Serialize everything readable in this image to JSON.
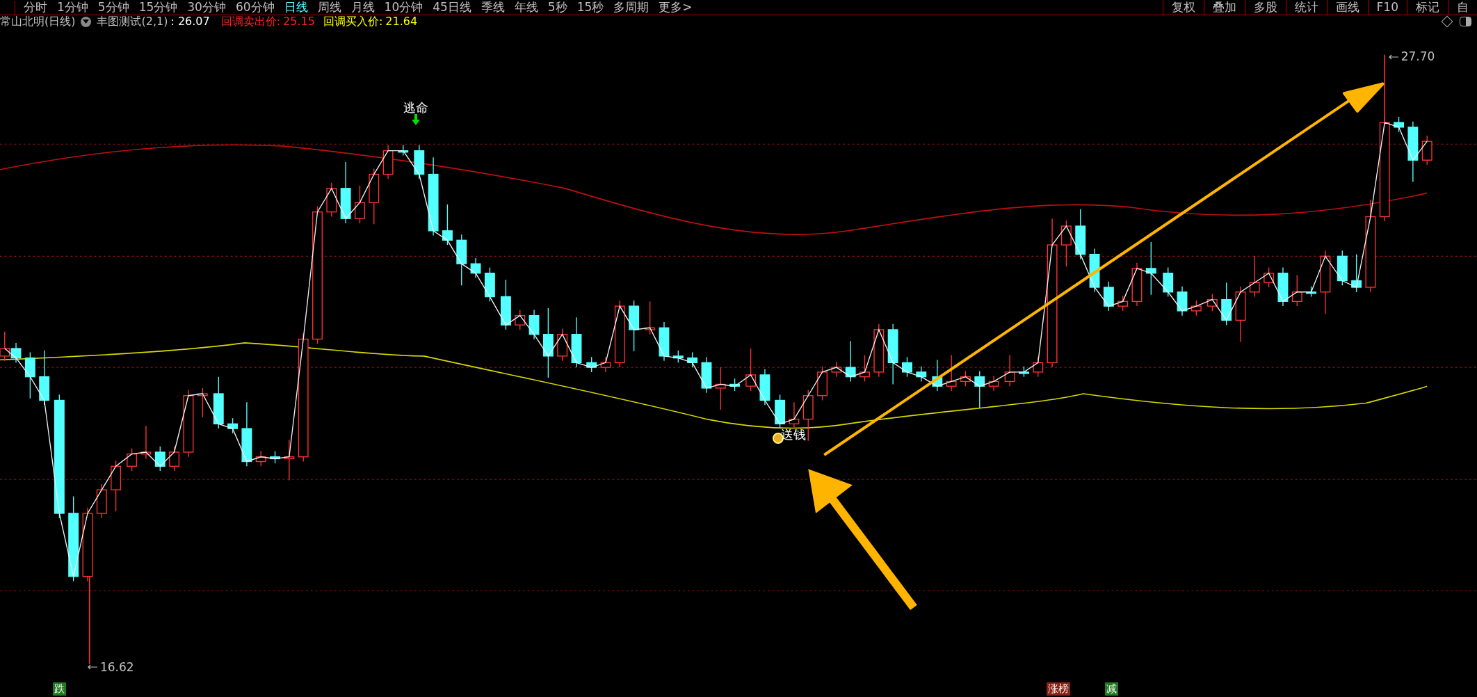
{
  "toolbar": {
    "periods": [
      {
        "label": "分时",
        "selected": false
      },
      {
        "label": "1分钟",
        "selected": false
      },
      {
        "label": "5分钟",
        "selected": false
      },
      {
        "label": "15分钟",
        "selected": false
      },
      {
        "label": "30分钟",
        "selected": false
      },
      {
        "label": "60分钟",
        "selected": false
      },
      {
        "label": "日线",
        "selected": true
      },
      {
        "label": "周线",
        "selected": false
      },
      {
        "label": "月线",
        "selected": false
      },
      {
        "label": "10分钟",
        "selected": false
      },
      {
        "label": "45日线",
        "selected": false
      },
      {
        "label": "季线",
        "selected": false
      },
      {
        "label": "年线",
        "selected": false
      },
      {
        "label": "5秒",
        "selected": false
      },
      {
        "label": "15秒",
        "selected": false
      },
      {
        "label": "多周期",
        "selected": false
      },
      {
        "label": "更多>",
        "selected": false
      }
    ],
    "buttons": [
      "复权",
      "叠加",
      "多股",
      "统计",
      "画线",
      "F10",
      "标记",
      "自"
    ]
  },
  "title_bar": {
    "stock": "常山北明(日线)",
    "indicator": "丰图测试(2,1)",
    "indicator_value": ": 26.07",
    "sell_price": {
      "label": "回调卖出价:",
      "value": "25.15"
    },
    "buy_price": {
      "label": "回调买入价:",
      "value": "21.64"
    }
  },
  "chart": {
    "signals": [
      {
        "label": "逃命",
        "kind": "sell"
      },
      {
        "label": "送钱",
        "kind": "buy"
      }
    ],
    "high_label": "27.70",
    "low_label": "16.62",
    "markers": [
      {
        "label": "跌",
        "color": "#1d7a1d"
      },
      {
        "label": "涨榜",
        "color": "#8a1f12"
      },
      {
        "label": "减",
        "color": "#1d7a1d"
      }
    ]
  }
}
